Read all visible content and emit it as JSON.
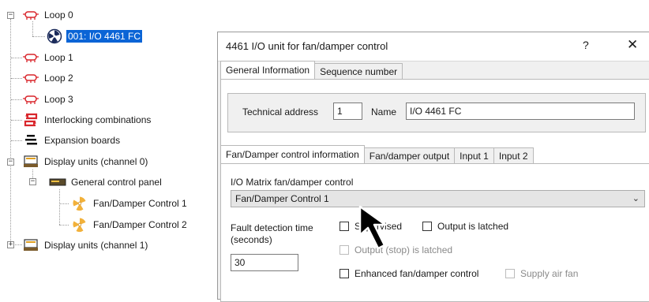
{
  "tree": {
    "items": [
      {
        "label": "Loop 0",
        "icon": "loop-icon",
        "expander": "−"
      },
      {
        "label": "001: I/O 4461 FC",
        "icon": "fan-unit-icon",
        "selected": true
      },
      {
        "label": "Loop 1",
        "icon": "loop-icon"
      },
      {
        "label": "Loop 2",
        "icon": "loop-icon"
      },
      {
        "label": "Loop 3",
        "icon": "loop-icon"
      },
      {
        "label": "Interlocking combinations",
        "icon": "interlocking-icon"
      },
      {
        "label": "Expansion boards",
        "icon": "expansion-board-icon"
      },
      {
        "label": "Display units (channel 0)",
        "icon": "display-unit-icon",
        "expander": "−"
      },
      {
        "label": "General control panel",
        "icon": "control-panel-icon",
        "expander": "−"
      },
      {
        "label": "Fan/Damper Control 1",
        "icon": "fan-icon"
      },
      {
        "label": "Fan/Damper Control 2",
        "icon": "fan-icon"
      },
      {
        "label": "Display units (channel 1)",
        "icon": "display-unit-icon",
        "expander": "+"
      }
    ]
  },
  "dialog": {
    "title": "4461 I/O unit for fan/damper control",
    "help": "?",
    "close": "✕",
    "top_tabs": [
      "General Information",
      "Sequence number"
    ],
    "technical_address_label": "Technical address",
    "technical_address_value": "1",
    "name_label": "Name",
    "name_value": "I/O 4461 FC",
    "inner_tabs": [
      "Fan/Damper control information",
      "Fan/damper output",
      "Input 1",
      "Input 2"
    ],
    "matrix_label": "I/O Matrix fan/damper control",
    "matrix_value": "Fan/Damper Control 1",
    "fault_label_line1": "Fault detection time",
    "fault_label_line2": "(seconds)",
    "fault_value": "30",
    "supervised_label": "Supervised",
    "output_latched_label": "Output is latched",
    "output_stop_latched_label": "Output (stop) is latched",
    "enhanced_label": "Enhanced fan/damper control",
    "supply_air_fan_label": "Supply air fan"
  },
  "colors": {
    "selection": "#0a64d6",
    "loop_icon": "#d9262c",
    "fan_icon": "#f2b13a",
    "dialog_bg": "#f0f0f0"
  }
}
